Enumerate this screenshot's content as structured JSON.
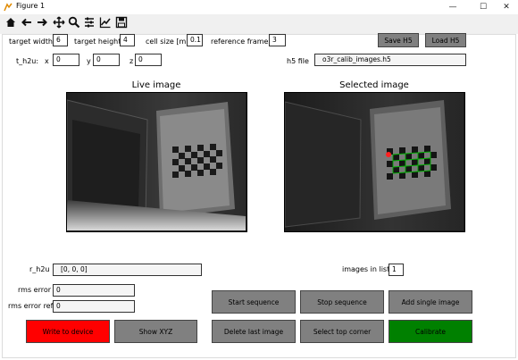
{
  "window": {
    "title": "Figure 1",
    "controls": {
      "minimize": "—",
      "maximize": "☐",
      "close": "✕"
    }
  },
  "toolbar": {
    "icons": [
      "home-icon",
      "back-arrow-icon",
      "forward-arrow-icon",
      "pan-icon",
      "zoom-icon",
      "configure-subplots-icon",
      "edit-axis-icon",
      "save-icon"
    ]
  },
  "params": {
    "target_width_label": "target width",
    "target_width_value": "6",
    "target_height_label": "target height",
    "target_height_value": "4",
    "cell_size_label": "cell size [m]",
    "cell_size_value": "0.1",
    "reference_frames_label": "reference frames",
    "reference_frames_value": "3",
    "save_h5": "Save H5",
    "load_h5": "Load H5"
  },
  "t_h2u": {
    "label": "t_h2u:",
    "x_label": "x",
    "x_value": "0",
    "y_label": "y",
    "y_value": "0",
    "z_label": "z",
    "z_value": "0",
    "h5_file_label": "h5 file",
    "h5_file_value": "o3r_calib_images.h5"
  },
  "images": {
    "live_title": "Live image",
    "selected_title": "Selected image"
  },
  "results": {
    "r_h2u_label": "r_h2u",
    "r_h2u_value": "[0, 0, 0]",
    "rms_error_label": "rms error",
    "rms_error_value": "0",
    "rms_error_ref_label": "rms error ref",
    "rms_error_ref_value": "0",
    "images_in_list_label": "images in list",
    "images_in_list_value": "1"
  },
  "buttons": {
    "write_to_device": "Write to device",
    "show_xyz": "Show XYZ",
    "start_sequence": "Start sequence",
    "stop_sequence": "Stop sequence",
    "add_single_image": "Add single image",
    "delete_last_image": "Delete last image",
    "select_top_corner": "Select top corner",
    "calibrate": "Calibrate"
  },
  "colors": {
    "button_gray": "#808080",
    "write_red": "#ff0000",
    "calibrate_green": "#008000",
    "toolbar_bg": "#f0f0f0"
  }
}
